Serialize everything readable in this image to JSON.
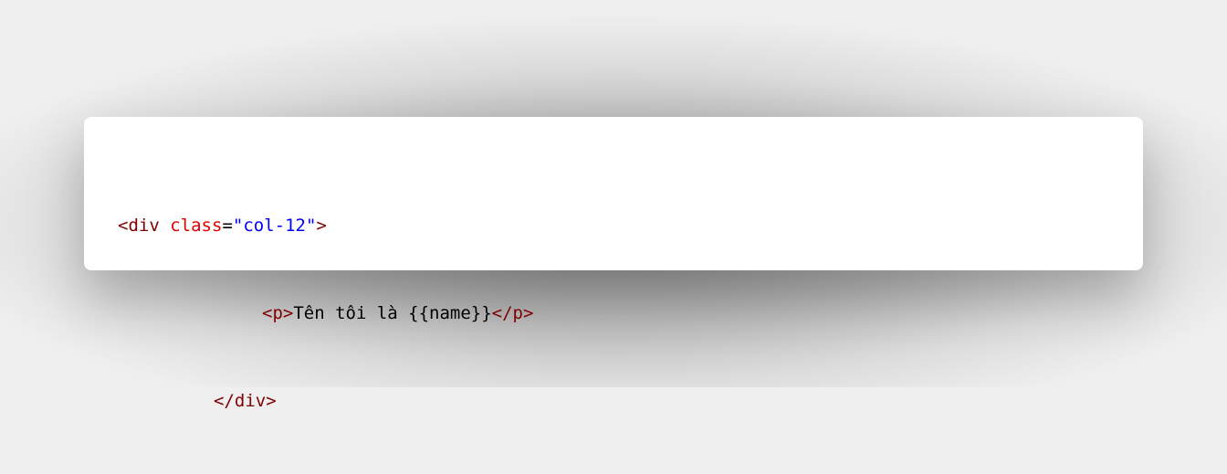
{
  "code": {
    "colors": {
      "tag": "#800000",
      "attr_name": "#e50000",
      "attr_value": "#0000ff",
      "text": "#000000"
    },
    "line1": {
      "open_bracket": "<",
      "tag": "div",
      "space": " ",
      "attr_name": "class",
      "equals": "=",
      "attr_value": "\"col-12\"",
      "close_bracket": ">"
    },
    "line2": {
      "open_tag": "<p>",
      "text": "Tên tôi là {{name}}",
      "close_tag": "</p>"
    },
    "line3": {
      "close_tag": "</div>"
    }
  }
}
